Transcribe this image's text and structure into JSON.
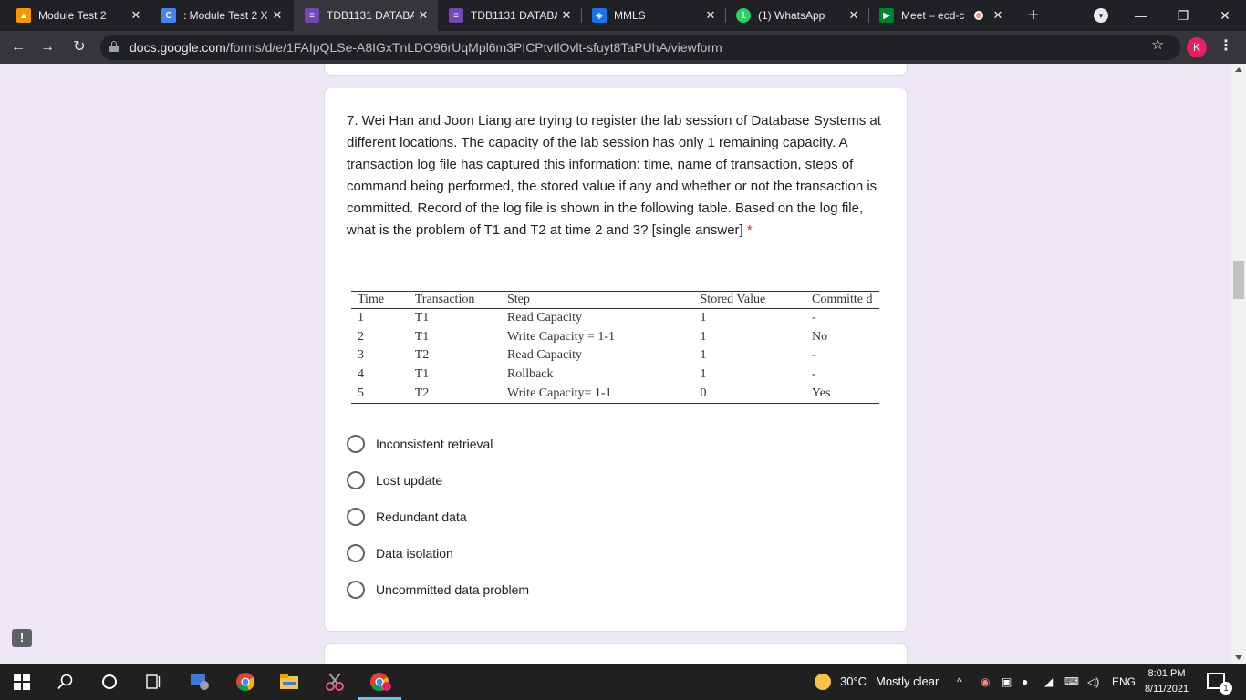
{
  "browser": {
    "tabs": [
      {
        "title": "Module Test 2",
        "icon": "user-card-icon",
        "color": "#f29900"
      },
      {
        "title": ": Module Test 2 X",
        "icon": "c-logo-icon",
        "color": "#4285f4"
      },
      {
        "title": "TDB1131 DATABA",
        "icon": "forms-icon",
        "color": "#7248b9"
      },
      {
        "title": "TDB1131 DATABA",
        "icon": "forms-icon",
        "color": "#7248b9"
      },
      {
        "title": "MMLS",
        "icon": "mmls-icon",
        "color": "#1a73e8"
      },
      {
        "title": "(1) WhatsApp",
        "icon": "whatsapp-icon",
        "color": "#25d366"
      },
      {
        "title": "Meet – ecd-c",
        "icon": "meet-icon",
        "color": "#00832d"
      }
    ],
    "url_host": "docs.google.com",
    "url_path": "/forms/d/e/1FAIpQLSe-A8IGxTnLDO96rUqMpl6m3PICPtvtlOvlt-sfuyt8TaPUhA/viewform",
    "profile_initial": "K",
    "profile_color": "#e91e63"
  },
  "question": {
    "text": "7. Wei Han and Joon Liang are trying to register the lab session of Database Systems at different locations. The capacity of the lab session has only 1 remaining capacity. A transaction log file has captured this information: time, name of transaction, steps of command being performed, the stored value if any and whether or not the transaction is committed. Record of the log file is shown in the following table. Based on the log file, what is the problem of T1 and T2 at time 2 and 3? [single answer]",
    "required_mark": "*",
    "table": {
      "headers": [
        "Time",
        "Transaction",
        "Step",
        "Stored Value",
        "Committe d"
      ],
      "rows": [
        [
          "1",
          "T1",
          "Read Capacity",
          "1",
          "-"
        ],
        [
          "2",
          "T1",
          "Write Capacity = 1-1",
          "1",
          "No"
        ],
        [
          "3",
          "T2",
          "Read Capacity",
          "1",
          "-"
        ],
        [
          "4",
          "T1",
          "Rollback",
          "1",
          "-"
        ],
        [
          "5",
          "T2",
          "Write Capacity= 1-1",
          "0",
          "Yes"
        ]
      ]
    },
    "options": [
      "Inconsistent retrieval",
      "Lost update",
      "Redundant data",
      "Data isolation",
      "Uncommitted data problem"
    ]
  },
  "taskbar": {
    "weather_temp": "30°C",
    "weather_desc": "Mostly clear",
    "language": "ENG",
    "time": "8:01 PM",
    "date": "8/11/2021",
    "notification_count": "1"
  }
}
